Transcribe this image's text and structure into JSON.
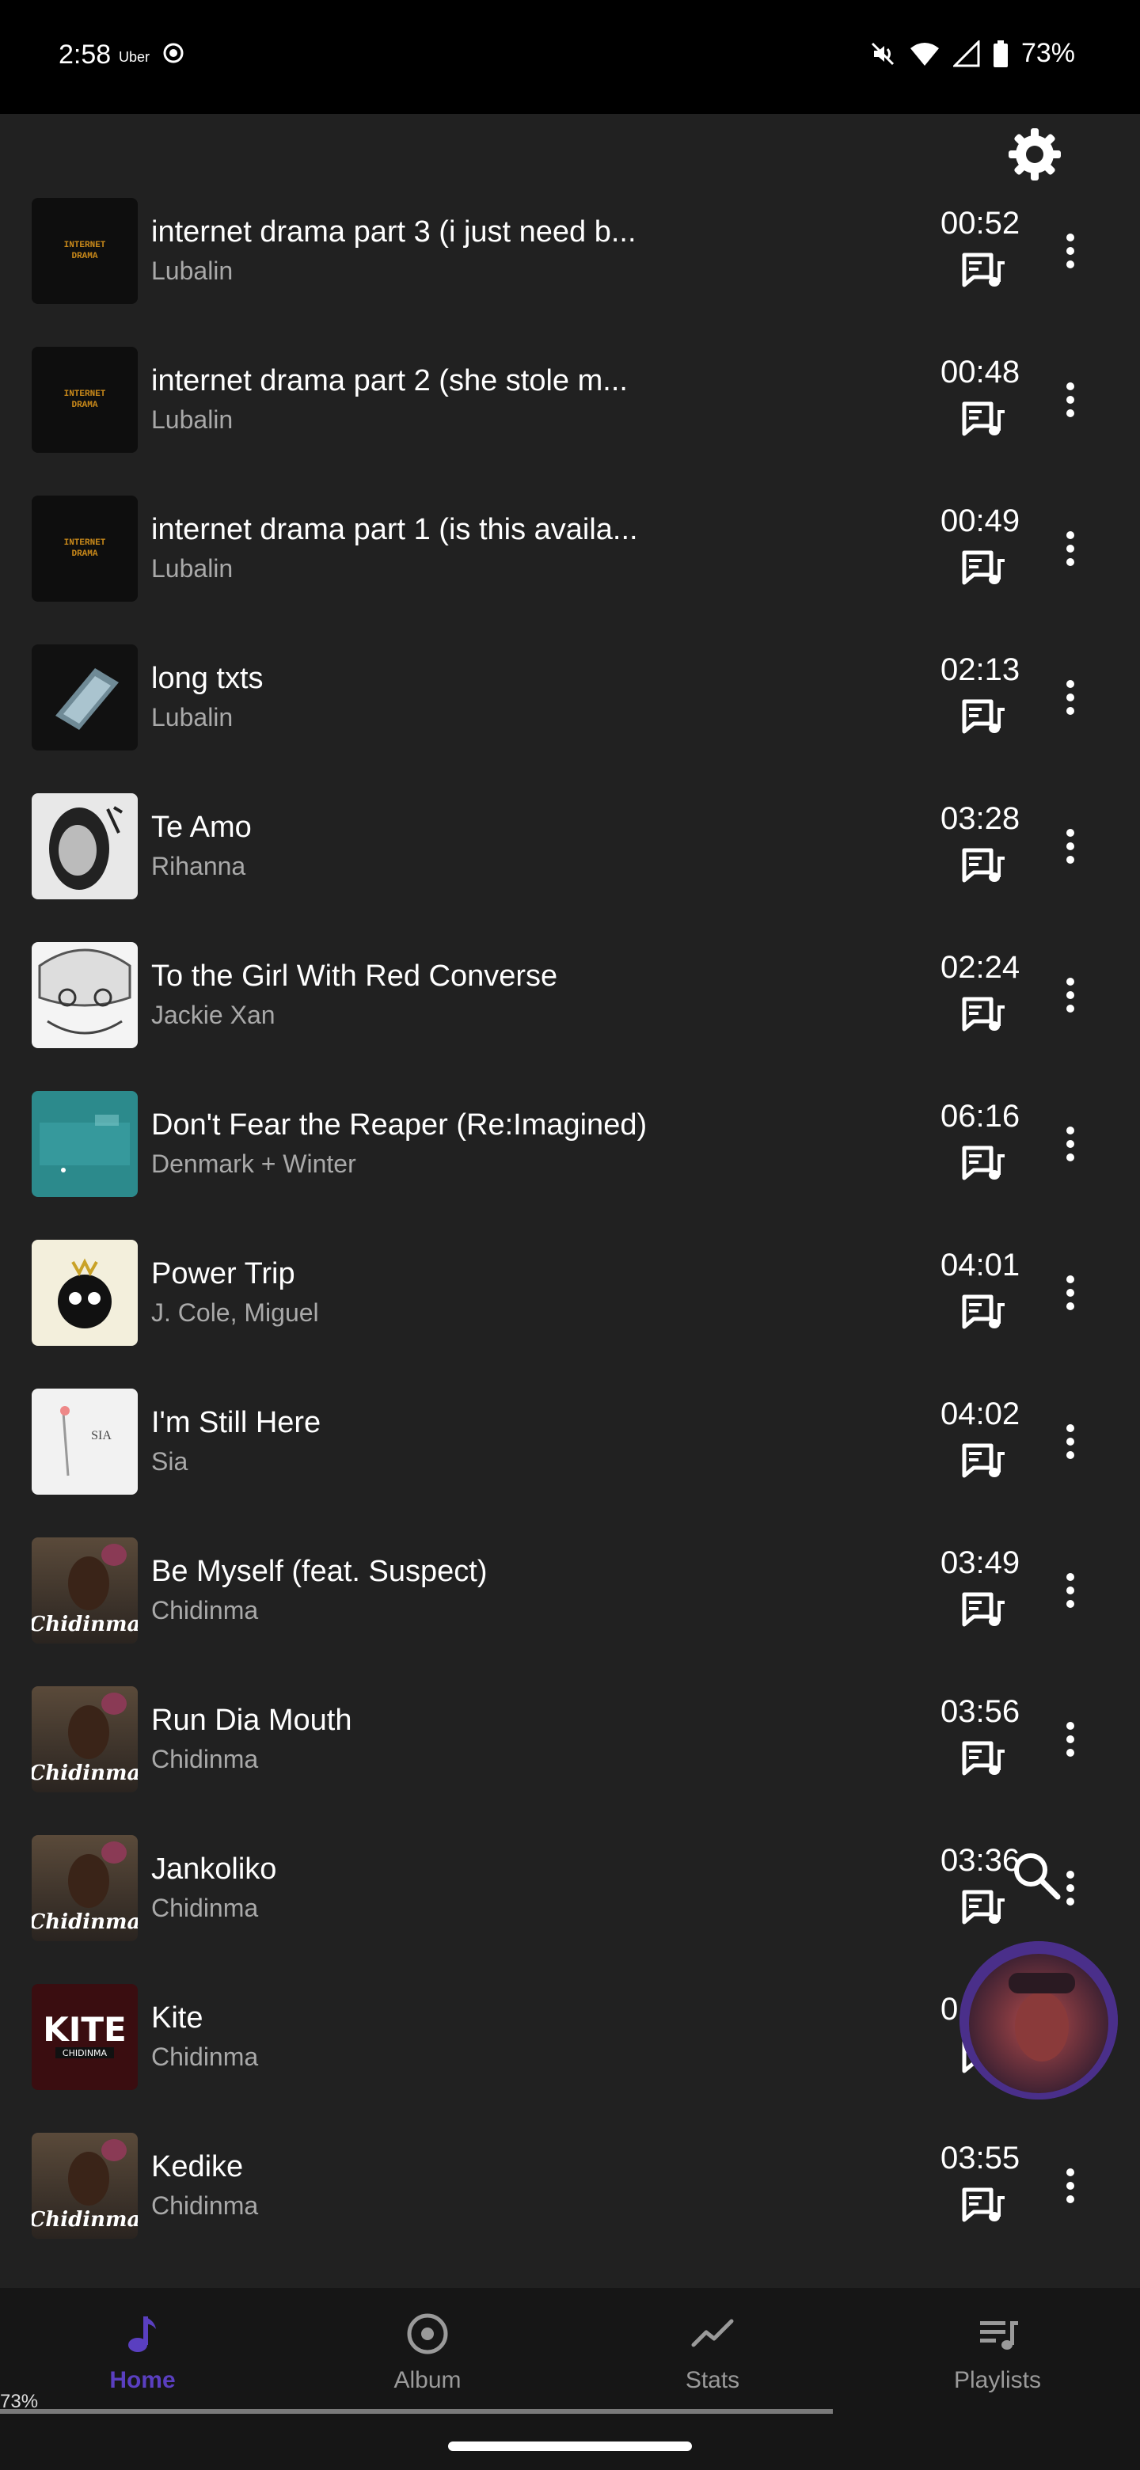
{
  "status_bar": {
    "time": "2:58",
    "uber_label": "Uber",
    "battery": "73%"
  },
  "songs": [
    {
      "title": "internet drama part 3 (i just need b...",
      "artist": "Lubalin",
      "duration": "00:52",
      "art": "internet-drama"
    },
    {
      "title": "internet drama part 2 (she stole m...",
      "artist": "Lubalin",
      "duration": "00:48",
      "art": "internet-drama"
    },
    {
      "title": "internet drama part 1 (is this availa...",
      "artist": "Lubalin",
      "duration": "00:49",
      "art": "internet-drama"
    },
    {
      "title": "long txts",
      "artist": "Lubalin",
      "duration": "02:13",
      "art": "long-txts"
    },
    {
      "title": "Te Amo",
      "artist": "Rihanna",
      "duration": "03:28",
      "art": "rihanna"
    },
    {
      "title": "To the Girl With Red Converse",
      "artist": "Jackie Xan",
      "duration": "02:24",
      "art": "jackie"
    },
    {
      "title": "Don't Fear the Reaper (Re:Imagined)",
      "artist": "Denmark + Winter",
      "duration": "06:16",
      "art": "denmark"
    },
    {
      "title": "Power Trip",
      "artist": "J. Cole, Miguel",
      "duration": "04:01",
      "art": "jcole"
    },
    {
      "title": "I'm Still Here",
      "artist": "Sia",
      "duration": "04:02",
      "art": "sia"
    },
    {
      "title": "Be Myself (feat. Suspect)",
      "artist": "Chidinma",
      "duration": "03:49",
      "art": "chidinma"
    },
    {
      "title": "Run Dia Mouth",
      "artist": "Chidinma",
      "duration": "03:56",
      "art": "chidinma"
    },
    {
      "title": "Jankoliko",
      "artist": "Chidinma",
      "duration": "03:36",
      "art": "chidinma"
    },
    {
      "title": "Kite",
      "artist": "Chidinma",
      "duration": "0",
      "art": "kite"
    },
    {
      "title": "Kedike",
      "artist": "Chidinma",
      "duration": "03:55",
      "art": "chidinma"
    }
  ],
  "art_text": {
    "internet_drama": "INTERNET DRAMA",
    "chidinma": "Chidinma",
    "kite": "KITE",
    "kite_sub": "CHIDINMA",
    "sia": "SIA"
  },
  "nav": {
    "items": [
      {
        "label": "Home",
        "icon": "music-note-icon",
        "active": true
      },
      {
        "label": "Album",
        "icon": "disc-icon",
        "active": false
      },
      {
        "label": "Stats",
        "icon": "stats-icon",
        "active": false
      },
      {
        "label": "Playlists",
        "icon": "playlist-icon",
        "active": false
      }
    ]
  },
  "colors": {
    "background": "#212121",
    "accent": "#5a3fc0",
    "secondary_text": "#a9a9a9",
    "nav_background": "#161616"
  }
}
